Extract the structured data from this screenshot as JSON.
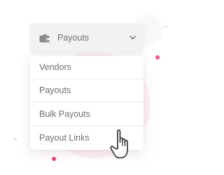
{
  "dropdown": {
    "selected_label": "Payouts",
    "icon": "wallet-icon",
    "toggle_icon": "chevron-down-icon",
    "options": [
      {
        "label": "Vendors"
      },
      {
        "label": "Payouts"
      },
      {
        "label": "Bulk Payouts"
      },
      {
        "label": "Payout Links"
      }
    ]
  },
  "cursor": {
    "icon": "hand-pointer-icon"
  },
  "colors": {
    "accent_pink": "#ec3f84",
    "text_grey": "#6f6f73",
    "header_bg": "#f2f2f3",
    "background_blob": "#fbe6ef"
  }
}
